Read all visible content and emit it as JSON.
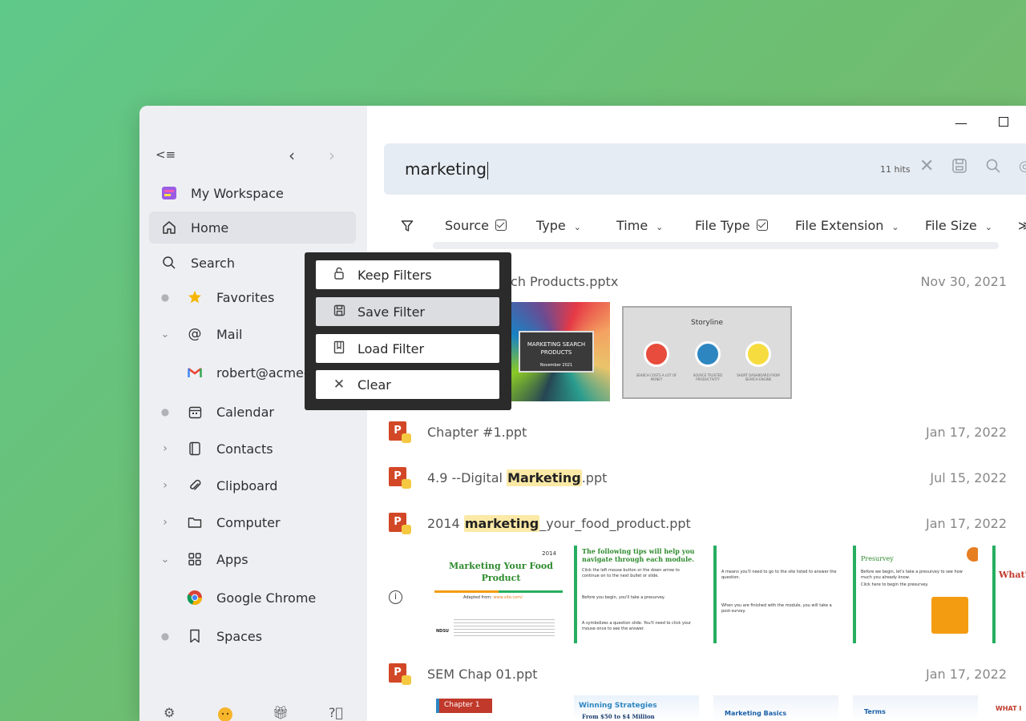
{
  "sidebar": {
    "collapse_icon": "<≡",
    "back_icon": "‹",
    "forward_icon": "›",
    "items": [
      {
        "label": "My Workspace",
        "icon": "workspace-icon"
      },
      {
        "label": "Home",
        "icon": "home-icon",
        "active": true
      },
      {
        "label": "Search",
        "icon": "search-icon"
      },
      {
        "label": "Favorites",
        "icon": "star-icon"
      },
      {
        "label": "Mail",
        "icon": "at-icon"
      },
      {
        "label": "robert@acme-c",
        "icon": "gmail-icon"
      },
      {
        "label": "Calendar",
        "icon": "calendar-icon"
      },
      {
        "label": "Contacts",
        "icon": "contacts-icon"
      },
      {
        "label": "Clipboard",
        "icon": "clipboard-icon"
      },
      {
        "label": "Computer",
        "icon": "folder-icon"
      },
      {
        "label": "Apps",
        "icon": "apps-icon"
      },
      {
        "label": "Google Chrome",
        "icon": "chrome-icon"
      },
      {
        "label": "Spaces",
        "icon": "bookmark-icon"
      }
    ]
  },
  "search": {
    "query": "marketing",
    "hits": "11 hits"
  },
  "filters": [
    {
      "label": "Source",
      "control": "checkbox"
    },
    {
      "label": "Type",
      "control": "dropdown"
    },
    {
      "label": "Time",
      "control": "dropdown"
    },
    {
      "label": "File Type",
      "control": "checkbox"
    },
    {
      "label": "File Extension",
      "control": "dropdown"
    },
    {
      "label": "File Size",
      "control": "dropdown"
    }
  ],
  "results": [
    {
      "title": "arch Products.pptx",
      "date": "Nov 30, 2021"
    },
    {
      "title": "Chapter #1.ppt",
      "date": "Jan 17, 2022"
    },
    {
      "title_pre": "4.9 --Digital ",
      "title_hl": "Marketing",
      "title_post": ".ppt",
      "date": "Jul 15, 2022"
    },
    {
      "title_pre": "2014 ",
      "title_hl": "marketing",
      "title_post": "_your_food_product.ppt",
      "date": "Jan 17, 2022"
    },
    {
      "title": "SEM Chap 01.ppt",
      "date": "Jan 17, 2022"
    }
  ],
  "thumbnails": {
    "marketing_search_title": "MARKETING SEARCH PRODUCTS",
    "marketing_search_sub": "November 2021",
    "storyline_title": "Storyline",
    "storyline_captions": [
      "SEARCH COSTS A LOT OF MONEY",
      "SOURCE TRUSTED PRODUCTIVITY",
      "SHORT DASHBOARD FROM SEARCH ENGINE"
    ],
    "food_title": "Marketing Your Food Product",
    "food_year": "2014",
    "food_adapted": "Adapted from:",
    "food_link": "www.site.com/",
    "food_org": "NDSU",
    "tips_title": "The following tips will help you navigate through each module.",
    "tips_lines": [
      "Click the left mouse button or the down arrow to continue on to the next bullet or slide.",
      "Before you begin, you'll take a presurvey.",
      "A symbolizes a question slide. You'll need to click your mouse once to see the answer."
    ],
    "means_line": "A means you'll need to go to the site listed to answer the question.",
    "means_line2": "When you are finished with the module, you will take a post-survey.",
    "presurvey_title": "Presurvey",
    "presurvey_text": "Before we begin, let's take a presurvey to see how much you already know.",
    "presurvey_link": "Click here to begin the presurvey.",
    "whats_text": "What's",
    "sem_chapter": "Chapter 1",
    "sem_winning": "Winning Strategies",
    "sem_from": "From $50 to $4 Million",
    "sem_basics": "Marketing Basics",
    "sem_terms": "Terms",
    "sem_what": "WHAT I"
  },
  "popup": {
    "items": [
      {
        "label": "Keep Filters",
        "icon": "lock-open-icon"
      },
      {
        "label": "Save Filter",
        "icon": "save-icon",
        "active": true
      },
      {
        "label": "Load Filter",
        "icon": "load-icon"
      },
      {
        "label": "Clear",
        "icon": "close-icon"
      }
    ]
  },
  "colors": {
    "accent_green": "#5fc98a",
    "sidebar_bg": "#eeeff3",
    "highlight": "#fbe9a6",
    "ppt_red": "#d24726"
  }
}
